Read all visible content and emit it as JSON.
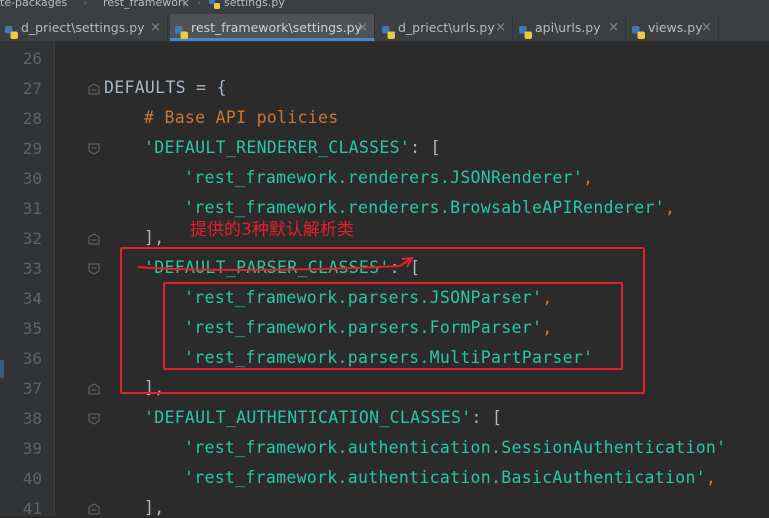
{
  "breadcrumb": [
    "te-packages",
    "rest_framework",
    "settings.py"
  ],
  "tabs": [
    {
      "label": "d_priect\\settings.py",
      "active": false,
      "closable": true
    },
    {
      "label": "rest_framework\\settings.py",
      "active": true,
      "closable": true
    },
    {
      "label": "d_priect\\urls.py",
      "active": false,
      "closable": true
    },
    {
      "label": "api\\urls.py",
      "active": false,
      "closable": true
    },
    {
      "label": "views.py",
      "active": false,
      "closable": true
    }
  ],
  "close_glyph": "×",
  "line_numbers": [
    "26",
    "27",
    "28",
    "29",
    "30",
    "31",
    "32",
    "33",
    "34",
    "35",
    "36",
    "37",
    "38",
    "39",
    "40",
    "41"
  ],
  "code": {
    "l27_name": "DEFAULTS",
    "l27_rest": " = {",
    "l28_comment": "# Base API policies",
    "l29_key": "'DEFAULT_RENDERER_CLASSES'",
    "l29_rest": ": [",
    "l30_val": "'rest_framework.renderers.JSONRenderer'",
    "l31_val": "'rest_framework.renderers.BrowsableAPIRenderer'",
    "l32": "],",
    "l33_key": "'DEFAULT_PARSER_CLASSES'",
    "l33_rest": ": [",
    "l34_val": "'rest_framework.parsers.JSONParser'",
    "l35_val": "'rest_framework.parsers.FormParser'",
    "l36_val": "'rest_framework.parsers.MultiPartParser'",
    "l37": "],",
    "l38_key": "'DEFAULT_AUTHENTICATION_CLASSES'",
    "l38_rest": ": [",
    "l39_val": "'rest_framework.authentication.SessionAuthentication'",
    "l40_val": "'rest_framework.authentication.BasicAuthentication'",
    "l41": "],",
    "comma": ","
  },
  "annotation": {
    "text": "提供的3种默认解析类",
    "color": "#e5202a"
  },
  "colors": {
    "background": "#2b2b2b",
    "gutter": "#313335",
    "string": "#29c7a6",
    "comment": "#cc7832",
    "punctuation": "#cc7832",
    "identifier": "#a9b7c6"
  },
  "icons": {
    "tab_file": "python-file-icon",
    "breadcrumb_file": "python-file-icon",
    "fold": "fold-marker-icon"
  }
}
